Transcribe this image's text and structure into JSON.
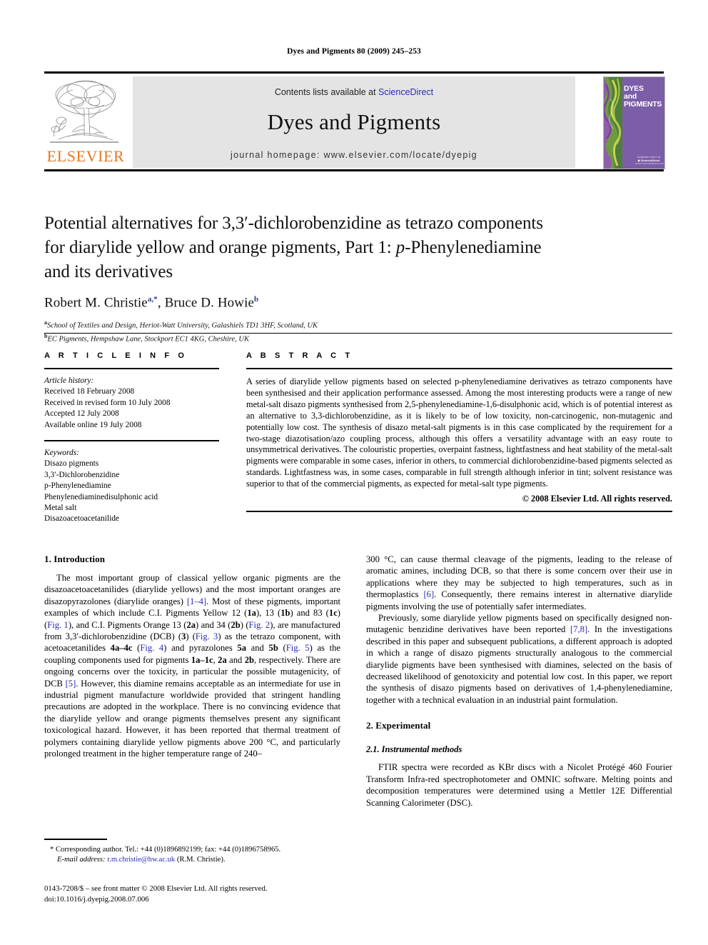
{
  "running_head": "Dyes and Pigments 80 (2009) 245–253",
  "masthead": {
    "contents_prefix": "Contents lists available at ",
    "sciencedirect": "ScienceDirect",
    "journal_title": "Dyes and Pigments",
    "homepage": "journal homepage: www.elsevier.com/locate/dyepig",
    "publisher_name": "ELSEVIER",
    "cover_title_line1": "DYES",
    "cover_title_line2": "and",
    "cover_title_line3": "PIGMENTS",
    "cover_footer": "Available online at\nScienceDirect\nwww.sciencedirect.com",
    "sciencedirect_color": "#2b2bb5",
    "publisher_color": "#E87722",
    "band_color": "#e4e4e4",
    "cover_bg_color": "#7b5ea7"
  },
  "article": {
    "title_line1": "Potential alternatives for 3,3′-dichlorobenzidine as tetrazo components",
    "title_line2_a": "for diarylide yellow and orange pigments, Part 1: ",
    "title_line2_italic": "p",
    "title_line2_b": "-Phenylenediamine",
    "title_line3": "and its derivatives",
    "authors": [
      {
        "name": "Robert M. Christie",
        "marks": "a,*"
      },
      {
        "name": "Bruce D. Howie",
        "marks": "b"
      }
    ],
    "affiliations": [
      {
        "mark": "a",
        "text": "School of Textiles and Design, Heriot-Watt University, Galashiels TD1 3HF, Scotland, UK"
      },
      {
        "mark": "b",
        "text": "EC Pigments, Hempshaw Lane, Stockport EC1 4KG, Cheshire, UK"
      }
    ]
  },
  "article_info": {
    "label": "A R T I C L E   I N F O",
    "history_label": "Article history:",
    "history": [
      "Received 18 February 2008",
      "Received in revised form 10 July 2008",
      "Accepted 12 July 2008",
      "Available online 19 July 2008"
    ],
    "keywords_label": "Keywords:",
    "keywords": [
      "Disazo pigments",
      "3,3′-Dichlorobenzidine",
      "p-Phenylenediamine",
      "Phenylenediaminedisulphonic acid",
      "Metal salt",
      "Disazoacetoacetanilide"
    ]
  },
  "abstract": {
    "label": "A B S T R A C T",
    "text": "A series of diarylide yellow pigments based on selected p-phenylenediamine derivatives as tetrazo components have been synthesised and their application performance assessed. Among the most interesting products were a range of new metal-salt disazo pigments synthesised from 2,5-phenylenediamine-1,6-disulphonic acid, which is of potential interest as an alternative to 3,3-dichlorobenzidine, as it is likely to be of low toxicity, non-carcinogenic, non-mutagenic and potentially low cost. The synthesis of disazo metal-salt pigments is in this case complicated by the requirement for a two-stage diazotisation/azo coupling process, although this offers a versatility advantage with an easy route to unsymmetrical derivatives. The colouristic properties, overpaint fastness, lightfastness and heat stability of the metal-salt pigments were comparable in some cases, inferior in others, to commercial dichlorobenzidine-based pigments selected as standards. Lightfastness was, in some cases, comparable in full strength although inferior in tint; solvent resistance was superior to that of the commercial pigments, as expected for metal-salt type pigments.",
    "copyright": "© 2008 Elsevier Ltd. All rights reserved."
  },
  "sections": {
    "introduction_heading": "1.  Introduction",
    "intro_p1": "The most important group of classical yellow organic pigments are the disazoacetoacetanilides (diarylide yellows) and the most important oranges are disazopyrazolones (diarylide oranges) [1–4]. Most of these pigments, important examples of which include C.I. Pigments Yellow 12 (1a), 13 (1b) and 83 (1c) (Fig. 1), and C.I. Pigments Orange 13 (2a) and 34 (2b) (Fig. 2), are manufactured from 3,3′-dichlorobenzidine (DCB) (3) (Fig. 3) as the tetrazo component, with acetoacetanilides 4a–4c (Fig. 4) and pyrazolones 5a and 5b (Fig. 5) as the coupling components used for pigments 1a–1c, 2a and 2b, respectively. There are ongoing concerns over the toxicity, in particular the possible mutagenicity, of DCB [5]. However, this diamine remains acceptable as an intermediate for use in industrial pigment manufacture worldwide provided that stringent handling precautions are adopted in the workplace. There is no convincing evidence that the diarylide yellow and orange pigments themselves present any significant toxicological hazard. However, it has been reported that thermal treatment of polymers containing diarylide yellow pigments above 200 °C, and particularly prolonged treatment in the higher temperature range of 240–300 °C, can cause thermal cleavage of the pigments, leading to the release of aromatic amines, including DCB, so that there is some concern over their use in applications where they may be subjected to high temperatures, such as in thermoplastics [6]. Consequently, there remains interest in alternative diarylide pigments involving the use of potentially safer intermediates.",
    "intro_p2": "Previously, some diarylide yellow pigments based on specifically designed non-mutagenic benzidine derivatives have been reported [7,8]. In the investigations described in this paper and subsequent publications, a different approach is adopted in which a range of disazo pigments structurally analogous to the commercial diarylide pigments have been synthesised with diamines, selected on the basis of decreased likelihood of genotoxicity and potential low cost. In this paper, we report the synthesis of disazo pigments based on derivatives of 1,4-phenylenediamine, together with a technical evaluation in an industrial paint formulation.",
    "experimental_heading": "2.  Experimental",
    "instrumental_heading": "2.1.  Instrumental methods",
    "instrumental_p1": "FTIR spectra were recorded as KBr discs with a Nicolet Protégé 460 Fourier Transform Infra-red spectrophotometer and OMNIC software. Melting points and decomposition temperatures were determined using a Mettler 12E Differential Scanning Calorimeter (DSC)."
  },
  "footnote": {
    "star": "*",
    "corresponding": "Corresponding author. Tel.: +44 (0)1896892199; fax: +44 (0)1896758965.",
    "email_label": "E-mail address:",
    "email": "r.m.christie@hw.ac.uk",
    "email_owner": "(R.M. Christie).",
    "link_color": "#2b2bb5"
  },
  "footer": {
    "issn_line": "0143-7208/$ – see front matter © 2008 Elsevier Ltd. All rights reserved.",
    "doi_line": "doi:10.1016/j.dyepig.2008.07.006"
  }
}
